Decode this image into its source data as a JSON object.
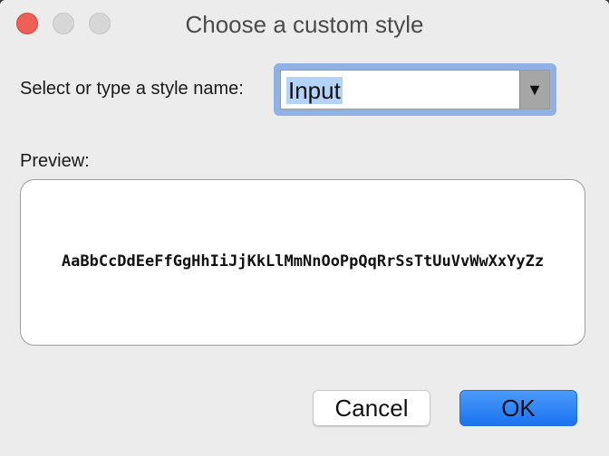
{
  "window": {
    "title": "Choose a custom style"
  },
  "form": {
    "style_label": "Select or type a style name:",
    "style_value": "Input",
    "dropdown_arrow": "▼",
    "preview_label": "Preview:",
    "preview_sample": "AaBbCcDdEeFfGgHhIiJjKkLlMmNnOoPpQqRrSsTtUuVvWwXxYyZz"
  },
  "buttons": {
    "cancel": "Cancel",
    "ok": "OK"
  },
  "colors": {
    "accent": "#1a73f0",
    "close": "#ee5f57",
    "selection": "#b4d3f9"
  }
}
